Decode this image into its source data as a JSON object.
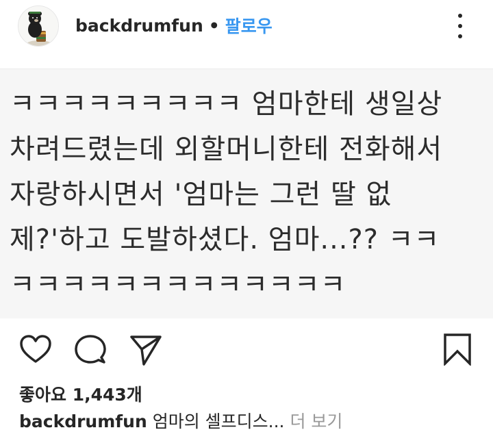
{
  "header": {
    "username": "backdrumfun",
    "separator": "•",
    "follow_label": "팔로우",
    "avatar_icon": "bear-drummer-avatar",
    "more_icon": "more-options-icon"
  },
  "post": {
    "text_lines": [
      "ㅋㅋㅋㅋㅋㅋㅋㅋㅋ 엄마한테 생일상",
      "차려드렸는데 외할머니한테 전화해서",
      "자랑하시면서 '엄마는 그런 딸 없",
      "제?'하고 도발하셨다. 엄마...?? ㅋㅋ",
      "ㅋㅋㅋㅋㅋㅋㅋㅋㅋㅋㅋㅋㅋ"
    ]
  },
  "actions": {
    "like_icon": "heart-icon",
    "comment_icon": "comment-icon",
    "share_icon": "share-icon",
    "save_icon": "bookmark-icon"
  },
  "likes": {
    "label": "좋아요 1,443개"
  },
  "caption": {
    "username": "backdrumfun",
    "text": " 엄마의 셀프디스...",
    "more_label": " 더 보기"
  },
  "colors": {
    "accent": "#3897f0",
    "text": "#262626",
    "muted": "#999999",
    "image_bg": "#f6f6f6"
  }
}
